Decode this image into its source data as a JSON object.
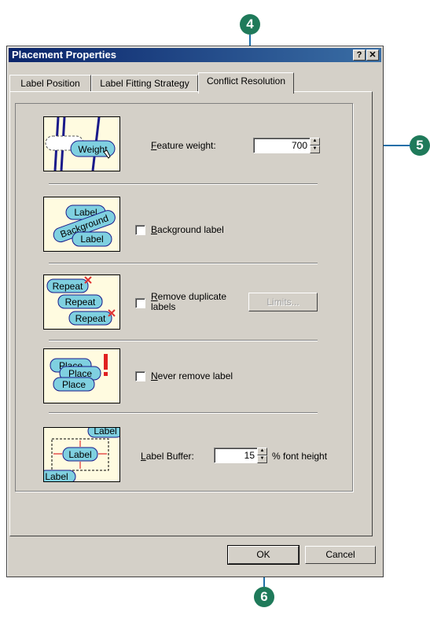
{
  "callouts": {
    "c4": "4",
    "c5": "5",
    "c6": "6"
  },
  "window": {
    "title": "Placement Properties",
    "help_button": "?",
    "close_button": "✕"
  },
  "tabs": [
    {
      "label": "Label Position"
    },
    {
      "label": "Label Fitting Strategy"
    },
    {
      "label": "Conflict Resolution"
    }
  ],
  "feature_weight": {
    "label_prefix": "F",
    "label_rest": "eature weight:",
    "value": "700",
    "thumb_text": "Weight"
  },
  "background_label": {
    "label_prefix": "B",
    "label_rest": "ackground label",
    "thumb_texts": [
      "Label",
      "Background",
      "Label"
    ]
  },
  "remove_duplicate": {
    "label_prefix": "R",
    "label_rest": "emove duplicate",
    "label_line2": "labels",
    "limits_button": "Limits...",
    "thumb_texts": [
      "Repeat",
      "Repeat",
      "Repeat"
    ]
  },
  "never_remove": {
    "label_prefix": "N",
    "label_rest": "ever remove label",
    "thumb_texts": [
      "Place",
      "Place",
      "Place"
    ]
  },
  "label_buffer": {
    "label_prefix": "L",
    "label_rest": "abel Buffer:",
    "value": "15",
    "units": "% font height",
    "thumb_texts": [
      "Label",
      "Label",
      "Label"
    ]
  },
  "footer": {
    "ok": "OK",
    "cancel": "Cancel"
  },
  "colors": {
    "callout": "#1f7a5a",
    "leader": "#1f6fa8",
    "titlebar": "#0a246a",
    "label_pill": "#7fd0e0",
    "thumb_bg": "#fffbe0"
  }
}
